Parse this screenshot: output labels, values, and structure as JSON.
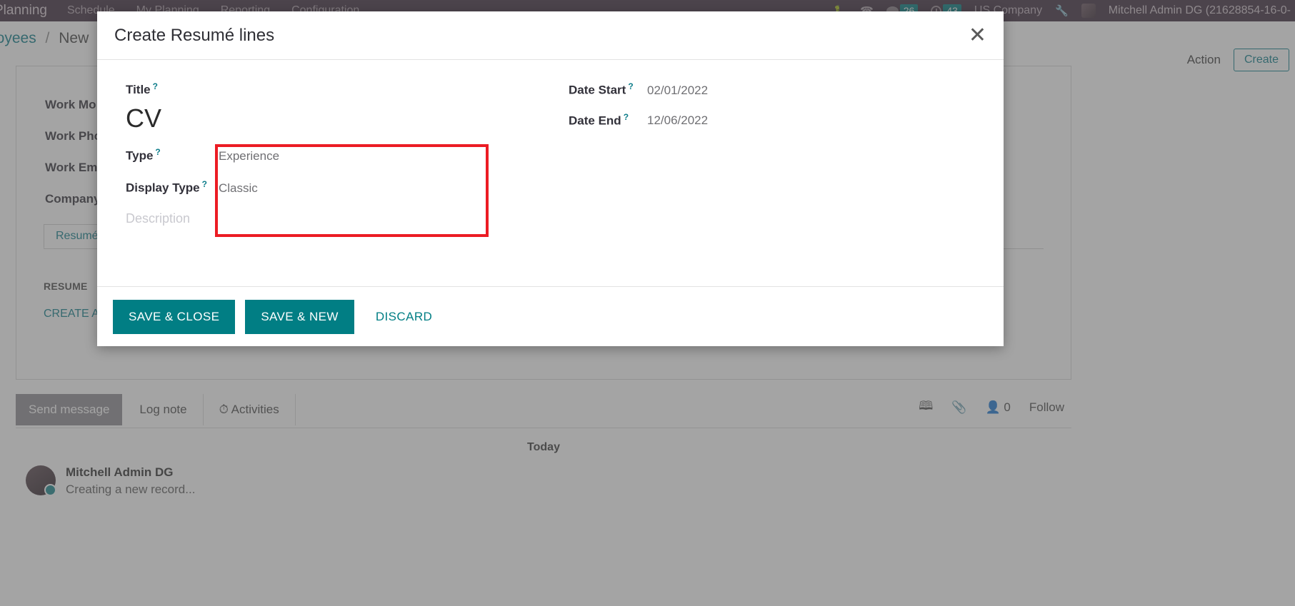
{
  "topbar": {
    "brand": "Planning",
    "menu": [
      "Schedule",
      "My Planning",
      "Reporting",
      "Configuration"
    ],
    "icons": [
      "bug-icon",
      "headset-icon",
      "messages-icon",
      "activities-icon",
      "settings-wrench-icon",
      "user-avatar"
    ],
    "messages_count": "26",
    "activities_count": "43",
    "company": "US Company",
    "user": "Mitchell Admin DG (21628854-16-0-",
    "bg_color": "#3c2c3c",
    "badge_color": "#017e84"
  },
  "breadcrumb": {
    "root": "loyees",
    "separator": "/",
    "current": "New",
    "action_label": "Action",
    "create_label": "Create"
  },
  "form": {
    "labels": [
      "Work Mo",
      "Work Pho",
      "Work Ema",
      "Company"
    ],
    "tab_label": "Resumé",
    "section_header": "RESUME",
    "create_link": "CREATE A"
  },
  "chatter": {
    "send_message": "Send message",
    "log_note": "Log note",
    "activities": "Activities",
    "attachments_count": "0",
    "follow_label": "Follow",
    "today_label": "Today",
    "message": {
      "author": "Mitchell Admin DG",
      "body": "Creating a new record..."
    }
  },
  "modal": {
    "title": "Create Resumé lines",
    "close_icon": "✕",
    "fields": {
      "title": {
        "label": "Title",
        "help": "?",
        "value": "CV"
      },
      "type": {
        "label": "Type",
        "help": "?",
        "value": "Experience"
      },
      "display_type": {
        "label": "Display Type",
        "help": "?",
        "value": "Classic"
      },
      "description": {
        "placeholder": "Description",
        "value": ""
      },
      "date_start": {
        "label": "Date Start",
        "help": "?",
        "value": "02/01/2022"
      },
      "date_end": {
        "label": "Date End",
        "help": "?",
        "value": "12/06/2022"
      }
    },
    "buttons": {
      "save_close": "SAVE & CLOSE",
      "save_new": "SAVE & NEW",
      "discard": "DISCARD"
    },
    "accent_color": "#017e84",
    "annotation_color": "#ec1c24"
  }
}
